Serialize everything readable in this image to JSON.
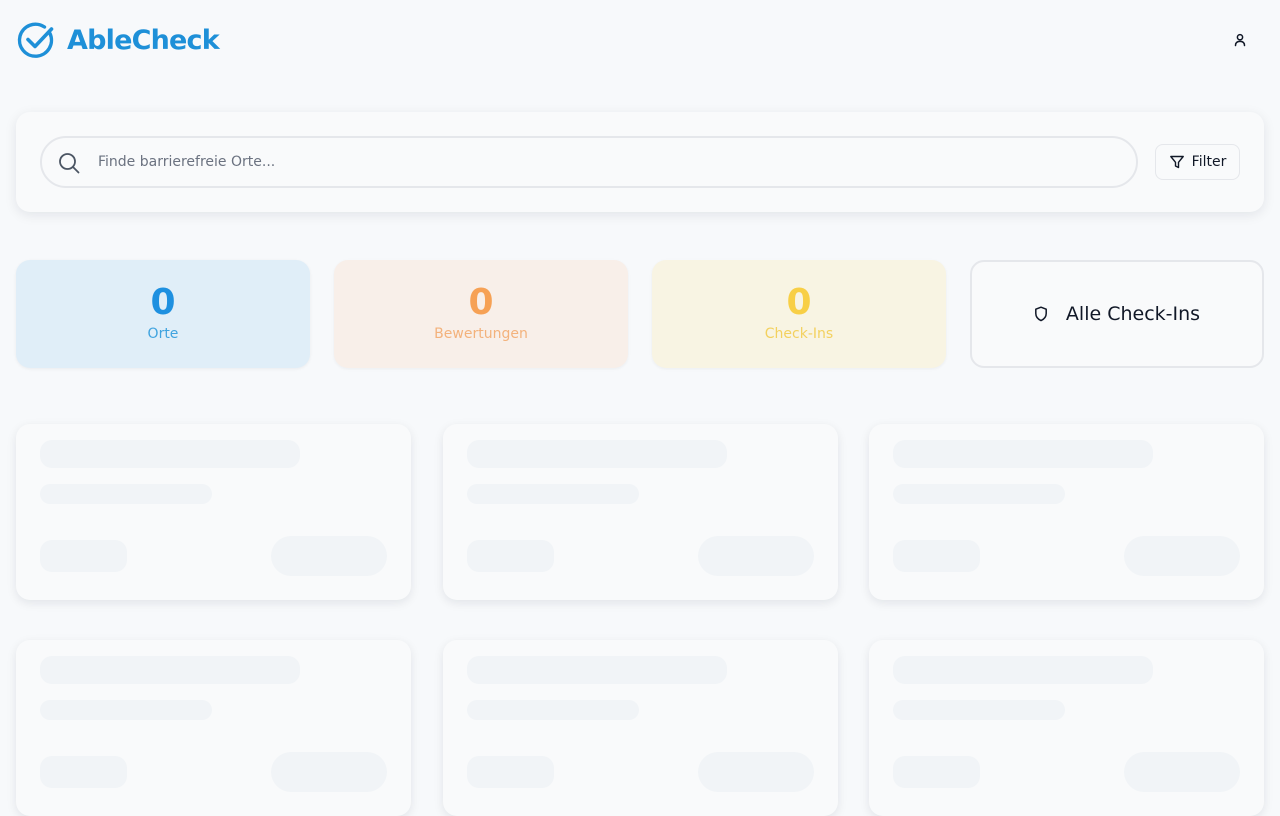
{
  "header": {
    "logo_text": "AbleCheck",
    "brand_color": "#1e90d8",
    "user_icon": "user-icon"
  },
  "search": {
    "placeholder": "Finde barrierefreie Orte...",
    "value": "",
    "icon": "search-icon"
  },
  "filter": {
    "label": "Filter",
    "icon": "filter-icon"
  },
  "stats": {
    "places": {
      "value": "0",
      "label": "Orte",
      "color": "#1e90e0"
    },
    "ratings": {
      "value": "0",
      "label": "Bewertungen",
      "color": "#f6a155"
    },
    "checkins": {
      "value": "0",
      "label": "Check-Ins",
      "color": "#f8cf46"
    }
  },
  "all_checkins": {
    "label": "Alle Check-Ins",
    "icon": "shield-icon"
  },
  "cards": {
    "state": "loading",
    "skeleton_count": 6
  }
}
